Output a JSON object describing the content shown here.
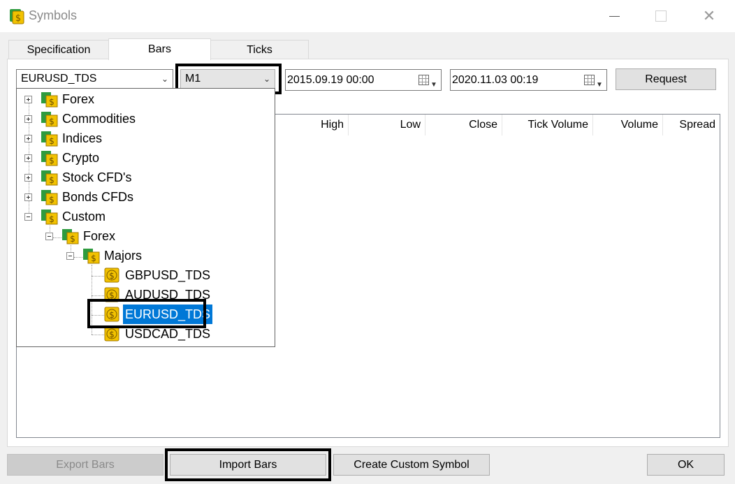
{
  "window": {
    "title": "Symbols",
    "icon": "symbols-app-icon"
  },
  "tabs": [
    {
      "label": "Specification",
      "active": false
    },
    {
      "label": "Bars",
      "active": true
    },
    {
      "label": "Ticks",
      "active": false
    }
  ],
  "toolbar": {
    "symbol": "EURUSD_TDS",
    "timeframe": "M1",
    "date_from": "2015.09.19 00:00",
    "date_to": "2020.11.03 00:19",
    "request_label": "Request"
  },
  "table": {
    "columns": [
      "High",
      "Low",
      "Close",
      "Tick Volume",
      "Volume",
      "Spread"
    ],
    "rows": []
  },
  "symbol_tree": {
    "items": [
      {
        "label": "Forex",
        "type": "folder",
        "state": "collapsed"
      },
      {
        "label": "Commodities",
        "type": "folder",
        "state": "collapsed"
      },
      {
        "label": "Indices",
        "type": "folder",
        "state": "collapsed"
      },
      {
        "label": "Crypto",
        "type": "folder",
        "state": "collapsed"
      },
      {
        "label": "Stock CFD's",
        "type": "folder",
        "state": "collapsed"
      },
      {
        "label": "Bonds CFDs",
        "type": "folder",
        "state": "collapsed"
      },
      {
        "label": "Custom",
        "type": "folder",
        "state": "expanded"
      },
      {
        "label": "Forex",
        "type": "folder",
        "state": "expanded"
      },
      {
        "label": "Majors",
        "type": "folder",
        "state": "expanded"
      },
      {
        "label": "GBPUSD_TDS",
        "type": "symbol"
      },
      {
        "label": "AUDUSD_TDS",
        "type": "symbol"
      },
      {
        "label": "EURUSD_TDS",
        "type": "symbol",
        "selected": true
      },
      {
        "label": "USDCAD_TDS",
        "type": "symbol"
      }
    ]
  },
  "footer": {
    "export_label": "Export Bars",
    "import_label": "Import Bars",
    "create_label": "Create Custom Symbol",
    "ok_label": "OK"
  },
  "colors": {
    "selection": "#0078d7",
    "folder_gold": "#e8b100",
    "folder_green": "#2e9b3e"
  }
}
